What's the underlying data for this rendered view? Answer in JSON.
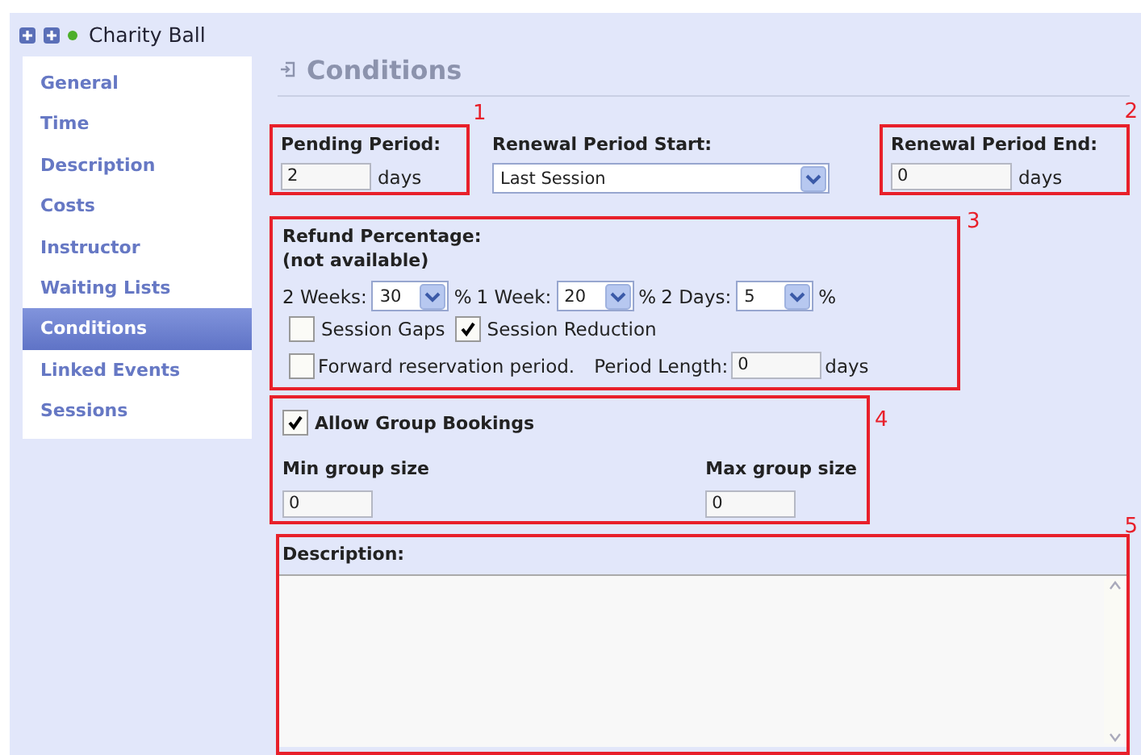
{
  "header": {
    "title": "Charity Ball"
  },
  "sidebar": {
    "items": [
      {
        "label": "General",
        "selected": false
      },
      {
        "label": "Time",
        "selected": false
      },
      {
        "label": "Description",
        "selected": false
      },
      {
        "label": "Costs",
        "selected": false
      },
      {
        "label": "Instructor",
        "selected": false
      },
      {
        "label": "Waiting Lists",
        "selected": false
      },
      {
        "label": "Conditions",
        "selected": true
      },
      {
        "label": "Linked Events",
        "selected": false
      },
      {
        "label": "Sessions",
        "selected": false
      }
    ]
  },
  "heading": "Conditions",
  "pending": {
    "callout": "1",
    "label": "Pending Period:",
    "value": "2",
    "unit": "days"
  },
  "renewal_start": {
    "label": "Renewal Period Start:",
    "value": "Last Session"
  },
  "renewal_end": {
    "callout": "2",
    "label": "Renewal Period End:",
    "value": "0",
    "unit": "days"
  },
  "refund": {
    "callout": "3",
    "title": "Refund Percentage:",
    "note": "(not available)",
    "percentages": [
      {
        "label": "2 Weeks:",
        "value": "30",
        "unit": "%"
      },
      {
        "label": "1 Week:",
        "value": "20",
        "unit": "%"
      },
      {
        "label": "2 Days:",
        "value": "5",
        "unit": "%"
      }
    ],
    "options": [
      {
        "label": "Session Gaps",
        "checked": false
      },
      {
        "label": "Session Reduction",
        "checked": true
      }
    ],
    "forward": {
      "label": "Forward reservation period.",
      "checked": false
    },
    "period_length": {
      "label": "Period Length:",
      "value": "0",
      "unit": "days"
    }
  },
  "group": {
    "callout": "4",
    "allow": {
      "label": "Allow Group Bookings",
      "checked": true
    },
    "min": {
      "label": "Min group size",
      "value": "0"
    },
    "max": {
      "label": "Max group size",
      "value": "0"
    }
  },
  "description": {
    "callout": "5",
    "label": "Description:"
  }
}
